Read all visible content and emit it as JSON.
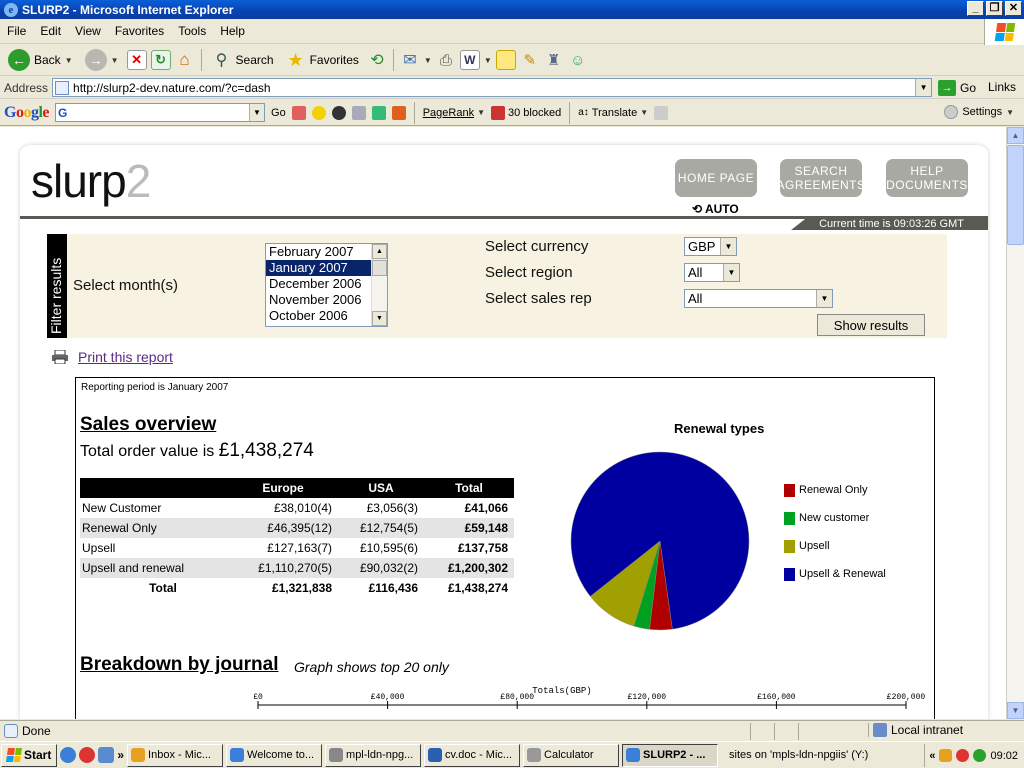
{
  "window": {
    "title": "SLURP2 - Microsoft Internet Explorer"
  },
  "menu": [
    "File",
    "Edit",
    "View",
    "Favorites",
    "Tools",
    "Help"
  ],
  "toolbar": {
    "back": "Back",
    "search": "Search",
    "favorites": "Favorites"
  },
  "address": {
    "label": "Address",
    "url": "http://slurp2-dev.nature.com/?c=dash",
    "go": "Go",
    "links": "Links"
  },
  "googlebar": {
    "logo": "Google",
    "go": "Go",
    "pagerank": "PageRank",
    "blocked": "30 blocked",
    "translate": "Translate",
    "settings": "Settings"
  },
  "site": {
    "logo_main": "slurp",
    "logo_num": "2",
    "nav": [
      {
        "label": "HOME PAGE"
      },
      {
        "label": "SEARCH AGREEMENTS"
      },
      {
        "label": "HELP DOCUMENTS"
      }
    ],
    "auto": "AUTO",
    "current_time": "Current time is 09:03:26 GMT"
  },
  "filter": {
    "tab": "Filter results",
    "month_label": "Select month(s)",
    "months": [
      "February 2007",
      "January 2007",
      "December 2006",
      "November 2006",
      "October 2006"
    ],
    "selected_month": "January 2007",
    "currency_label": "Select currency",
    "currency": "GBP",
    "region_label": "Select region",
    "region": "All",
    "rep_label": "Select sales rep",
    "rep": "All",
    "show_button": "Show results"
  },
  "print_link": "Print this report",
  "report": {
    "period": "Reporting period is January 2007",
    "sales_heading": "Sales overview",
    "total_prefix": "Total order value is",
    "total_value": "£1,438,274",
    "table": {
      "headers": [
        "",
        "Europe",
        "USA",
        "Total"
      ],
      "rows": [
        [
          "New Customer",
          "£38,010(4)",
          "£3,056(3)",
          "£41,066"
        ],
        [
          "Renewal Only",
          "£46,395(12)",
          "£12,754(5)",
          "£59,148"
        ],
        [
          "Upsell",
          "£127,163(7)",
          "£10,595(6)",
          "£137,758"
        ],
        [
          "Upsell and renewal",
          "£1,110,270(5)",
          "£90,032(2)",
          "£1,200,302"
        ],
        [
          "Total",
          "£1,321,838",
          "£116,436",
          "£1,438,274"
        ]
      ]
    },
    "journal_heading": "Breakdown by journal",
    "journal_note": "Graph shows top 20 only",
    "axis_title": "Totals(GBP)",
    "axis_ticks": [
      "£0",
      "£40,000",
      "£80,000",
      "£120,000",
      "£160,000",
      "£200,000"
    ]
  },
  "chart_data": {
    "type": "pie",
    "title": "Renewal types",
    "categories": [
      "Renewal Only",
      "New customer",
      "Upsell",
      "Upsell & Renewal"
    ],
    "values": [
      59148,
      41066,
      137758,
      1200302
    ],
    "colors": [
      "#b00000",
      "#00a020",
      "#a0a000",
      "#0000a0"
    ],
    "legend": "right"
  },
  "status": {
    "done": "Done",
    "zone": "Local intranet"
  },
  "taskbar": {
    "start": "Start",
    "tasks": [
      "Inbox - Mic...",
      "Welcome to...",
      "mpl-ldn-npg...",
      "cv.doc - Mic...",
      "Calculator",
      "SLURP2 - ..."
    ],
    "active_index": 5,
    "drive": "sites on 'mpls-ldn-npgiis' (Y:)",
    "clock": "09:02"
  }
}
